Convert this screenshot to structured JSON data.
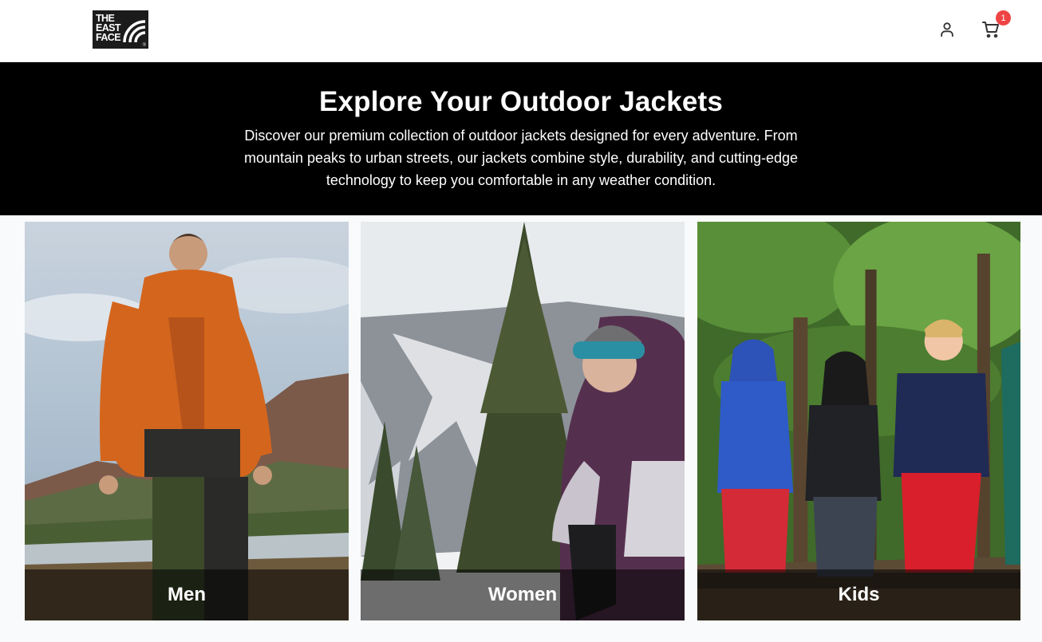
{
  "header": {
    "logo_lines": [
      "THE",
      "EAST",
      "FACE"
    ],
    "cart_count": "1"
  },
  "hero": {
    "title": "Explore Your Outdoor Jackets",
    "description": "Discover our premium collection of outdoor jackets designed for every adventure. From mountain peaks to urban streets, our jackets combine style, durability, and cutting-edge technology to keep you comfortable in any weather condition."
  },
  "categories": [
    {
      "label": "Men"
    },
    {
      "label": "Women"
    },
    {
      "label": "Kids"
    }
  ],
  "colors": {
    "hero_bg": "#000000",
    "badge": "#ef4444",
    "page_bg": "#f9fafb"
  }
}
